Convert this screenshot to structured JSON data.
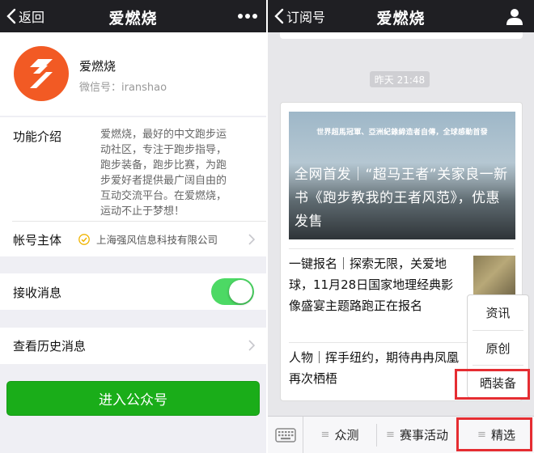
{
  "left": {
    "navbar": {
      "back_label": "返回",
      "title": "爱燃烧",
      "more_icon": "more-dots-icon"
    },
    "profile": {
      "name": "爱燃烧",
      "wechat_id": "微信号：iranshao"
    },
    "intro": {
      "label": "功能介绍",
      "lines": [
        "爱燃烧，最好的中文跑步运",
        "动社区，专注于跑步指导，",
        "跑步装备，跑步比赛，为跑",
        "步爱好者提供最广阔自由的",
        "互动交流平台。在爱燃烧，",
        "运动不止于梦想！"
      ]
    },
    "owner": {
      "label": "帐号主体",
      "value": "上海强风信息科技有限公司"
    },
    "receive": {
      "label": "接收消息",
      "enabled": true
    },
    "history": {
      "label": "查看历史消息"
    },
    "enter_button": "进入公众号"
  },
  "right": {
    "navbar": {
      "back_label": "订阅号",
      "title": "爱燃烧",
      "person_icon": "person-icon"
    },
    "time_badge": "昨天 21:48",
    "cover": {
      "small_caption": "世界超馬冠軍、亞洲紀錄締造者自傳，全球感動首發",
      "title": "全网首发｜“超马王者”关家良一新书《跑步教我的王者风范》，优惠发售"
    },
    "items": [
      {
        "title": "一键报名｜探索无限，关爱地球，11月28日国家地理经典影像盛宴主题路跑正在报名"
      },
      {
        "title": "人物｜挥手纽约，期待冉冉凤凰再次栖梧"
      }
    ],
    "popup_menu": [
      "资讯",
      "原创",
      "晒装备"
    ],
    "tabbar": {
      "tabs": [
        "众测",
        "赛事活动",
        "精选"
      ]
    }
  },
  "colors": {
    "navbar": "#1f1f23",
    "brand_orange": "#f25a24",
    "green_button": "#1aad19",
    "toggle_on": "#4cd964",
    "highlight_red": "#e52d32"
  }
}
